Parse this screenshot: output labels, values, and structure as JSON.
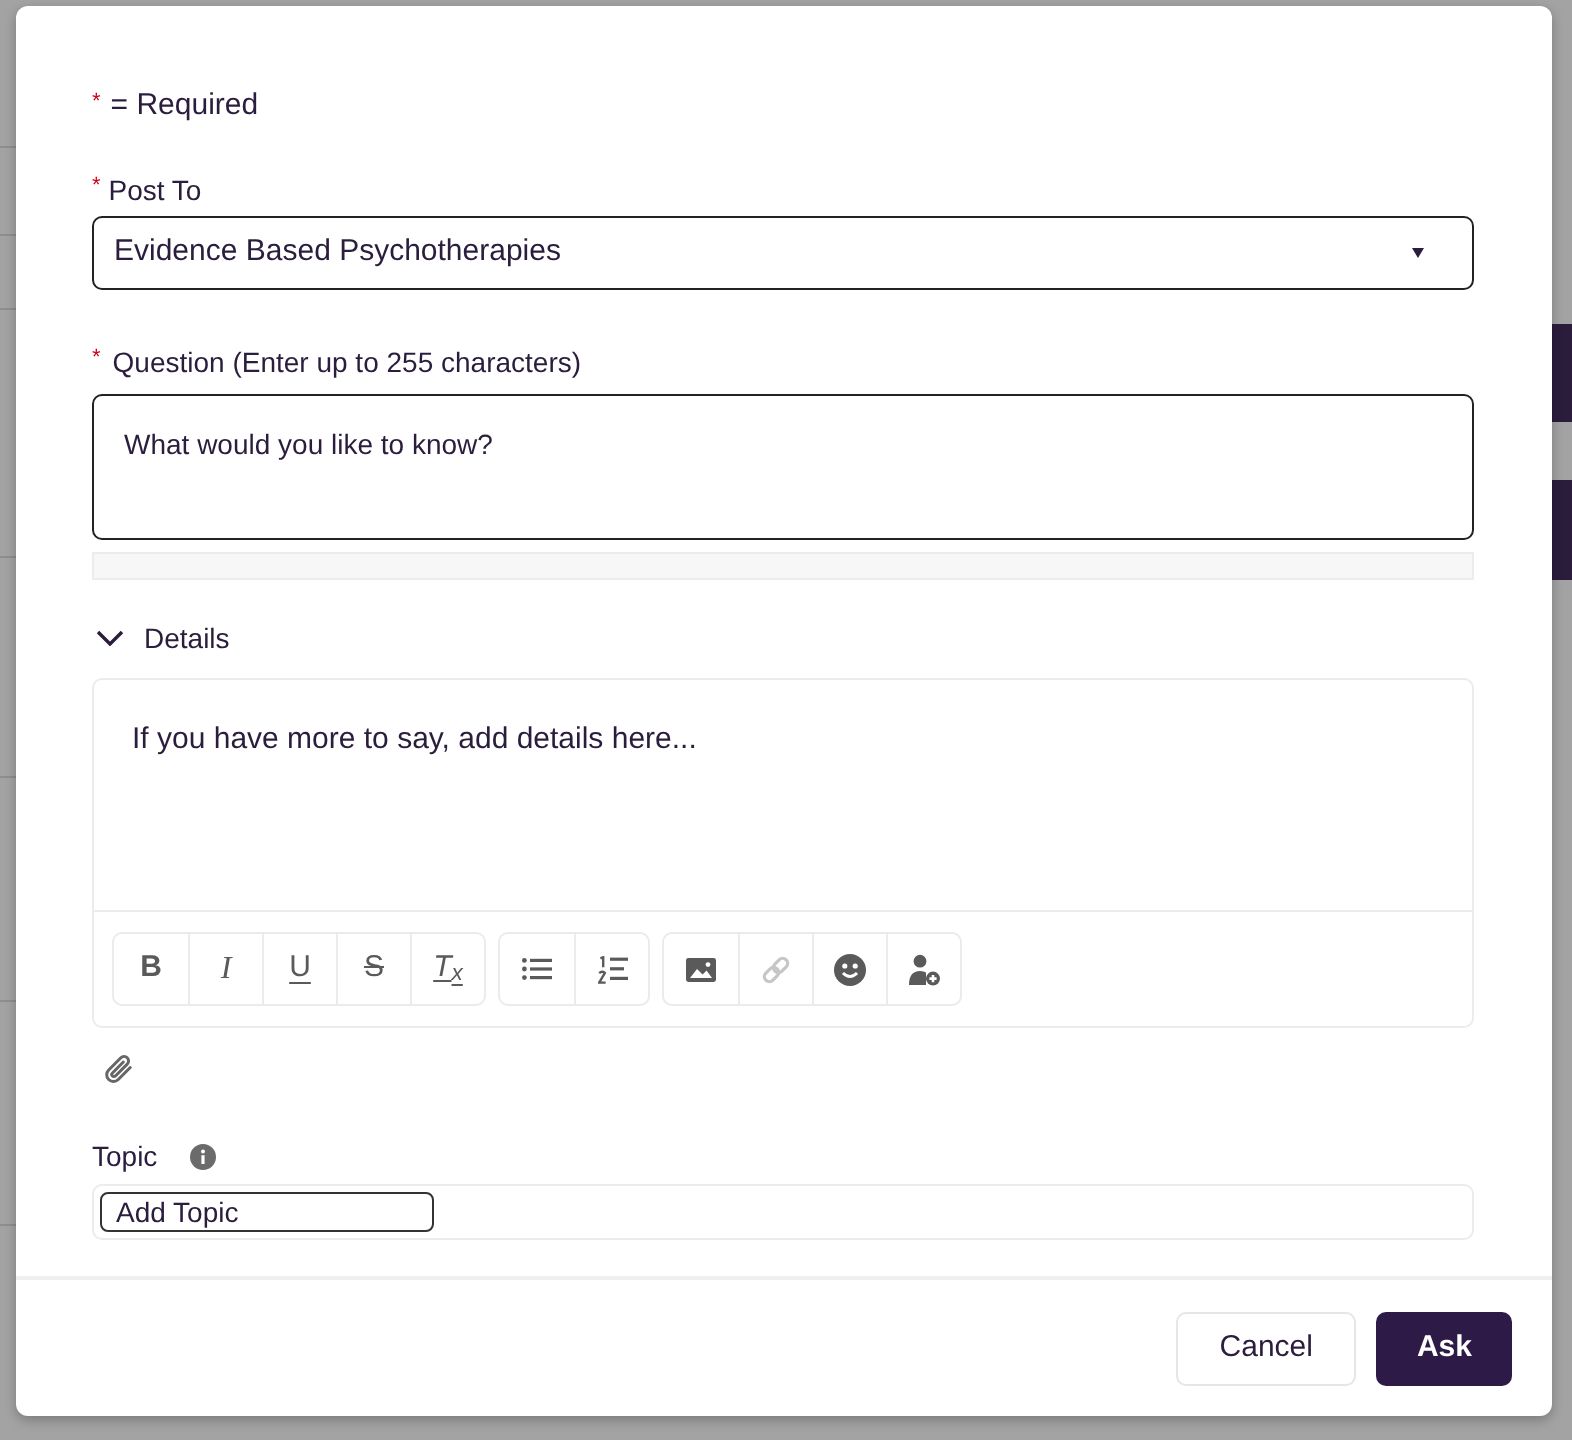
{
  "required_note": {
    "asterisk": "*",
    "text": "= Required"
  },
  "post_to": {
    "asterisk": "*",
    "label": "Post To",
    "value": "Evidence Based Psychotherapies"
  },
  "question": {
    "asterisk": "*",
    "label": "Question (Enter up to 255 characters)",
    "placeholder": "What would you like to know?"
  },
  "details": {
    "label": "Details",
    "expanded": true,
    "placeholder": "If you have more to say, add details here...",
    "toolbar_groups": [
      [
        {
          "kind": "bold",
          "glyph": "B",
          "disabled": false
        },
        {
          "kind": "italic",
          "glyph": "I",
          "disabled": false
        },
        {
          "kind": "underline",
          "glyph": "U",
          "disabled": false
        },
        {
          "kind": "strikethrough",
          "glyph": "S",
          "disabled": false
        },
        {
          "kind": "clear_format",
          "glyph": "T$_{x}$",
          "disabled": false
        }
      ],
      [
        {
          "kind": "bullet_list",
          "disabled": false
        },
        {
          "kind": "numbered_list",
          "disabled": false
        }
      ],
      [
        {
          "kind": "image",
          "disabled": false
        },
        {
          "kind": "link",
          "disabled": true
        },
        {
          "kind": "emoji",
          "disabled": false
        },
        {
          "kind": "mention",
          "disabled": false
        }
      ]
    ]
  },
  "topic": {
    "label": "Topic",
    "placeholder": "Add Topic"
  },
  "footer": {
    "buttons": [
      {
        "label": "Cancel",
        "kind": "secondary"
      },
      {
        "label": "Ask",
        "kind": "primary"
      }
    ]
  }
}
